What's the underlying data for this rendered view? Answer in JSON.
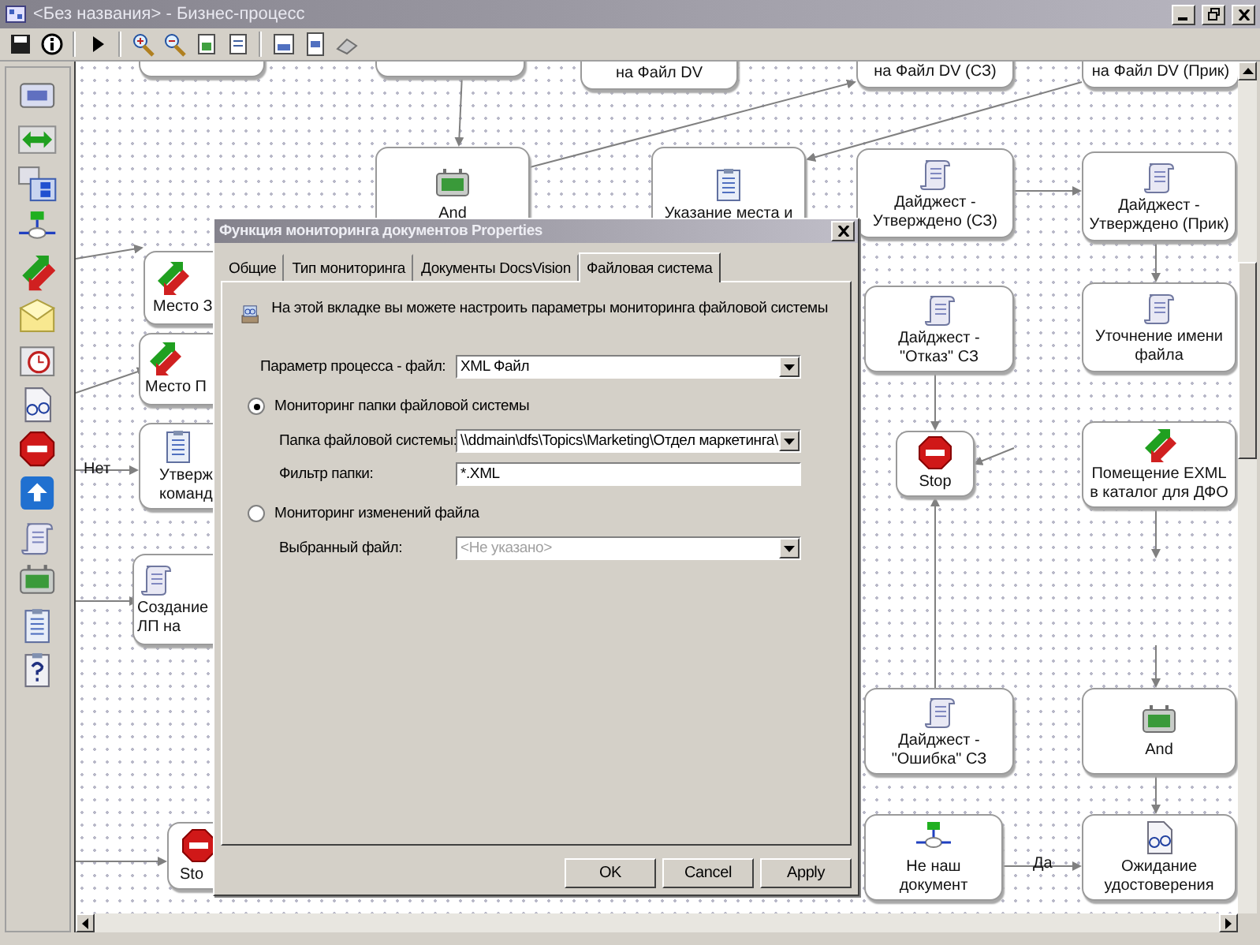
{
  "window": {
    "title": "<Без названия> - Бизнес-процесс"
  },
  "canvas": {
    "nodes": [
      {
        "kind": "none",
        "label": "на Файл DV"
      },
      {
        "kind": "none",
        "label": "на Файл DV (СЗ)"
      },
      {
        "kind": "none",
        "label": "на Файл DV (Прик)"
      },
      {
        "kind": "and",
        "label": "And"
      },
      {
        "kind": "document",
        "label": "Указание места и"
      },
      {
        "kind": "script",
        "label": "Дайджест - Утверждено (СЗ)"
      },
      {
        "kind": "script",
        "label": "Дайджест - Утверждено (Прик)"
      },
      {
        "kind": "transfer",
        "label": "Место З"
      },
      {
        "kind": "transfer",
        "label": "Место П"
      },
      {
        "kind": "script",
        "label": "Дайджест - \"Отказ\" СЗ"
      },
      {
        "kind": "script",
        "label": "Уточнение имени файла"
      },
      {
        "kind": "document",
        "label": "Утверж\nкоманд"
      },
      {
        "kind": "stop",
        "label": "Stop"
      },
      {
        "kind": "transfer",
        "label": "Помещение EXML в каталог для ДФО"
      },
      {
        "kind": "script",
        "label": "Создание\nЛП на"
      },
      {
        "kind": "script",
        "label": "Дайджест - \"Ошибка\" СЗ"
      },
      {
        "kind": "and",
        "label": "And"
      },
      {
        "kind": "stop",
        "label": "Sto"
      },
      {
        "kind": "split",
        "label": "Не наш документ"
      },
      {
        "kind": "wait",
        "label": "Ожидание удостоверения"
      }
    ],
    "edge_labels": [
      {
        "text": "Нет"
      },
      {
        "text": "Да"
      }
    ]
  },
  "dialog": {
    "title": "Функция мониторинга документов Properties",
    "tabs": [
      {
        "label": "Общие",
        "selected": false
      },
      {
        "label": "Тип мониторинга",
        "selected": false
      },
      {
        "label": "Документы DocsVision",
        "selected": false
      },
      {
        "label": "Файловая система",
        "selected": true
      }
    ],
    "info": "На этой вкладке вы можете настроить параметры мониторинга файловой системы",
    "process_param": {
      "label": "Параметр процесса - файл:",
      "value": "XML Файл"
    },
    "options": [
      {
        "label": "Мониторинг папки файловой системы",
        "selected": true,
        "fields": [
          {
            "kind": "combo",
            "label": "Папка файловой системы:",
            "value": "\\\\ddmain\\dfs\\Topics\\Marketing\\Отдел маркетинга\\",
            "disabled": false
          },
          {
            "kind": "text",
            "label": "Фильтр папки:",
            "value": "*.XML",
            "disabled": false
          }
        ]
      },
      {
        "label": "Мониторинг изменений файла",
        "selected": false,
        "fields": [
          {
            "kind": "combo",
            "label": "Выбранный файл:",
            "value": "<Не указано>",
            "disabled": true
          }
        ]
      }
    ],
    "buttons": [
      "OK",
      "Cancel",
      "Apply"
    ]
  }
}
